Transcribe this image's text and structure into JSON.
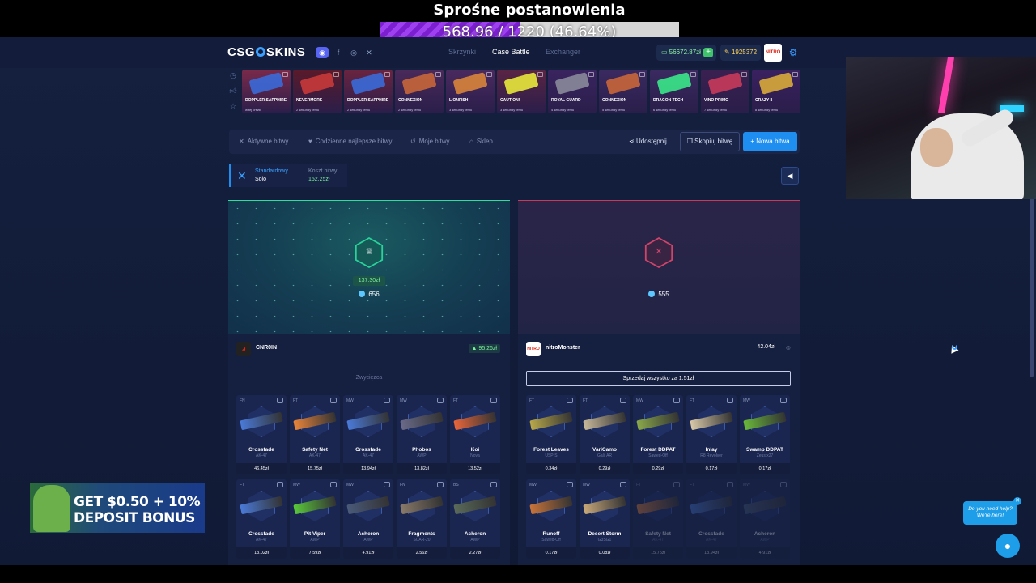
{
  "overlay": {
    "title": "Sprośne postanowienia",
    "progress_text": "568.96 / 1220 (46.64%)",
    "progress_fraction": 0.4664
  },
  "header": {
    "logo": "CSG",
    "logo_tail": "SKINS",
    "nav": [
      "Skrzynki",
      "Case Battle",
      "Exchanger"
    ],
    "balance": "56672.87zł",
    "coins": "1925372",
    "avatar_text": "NITRO"
  },
  "drops": [
    {
      "name": "DOPPLER SAPPHIRE",
      "sub": "w tej chwili",
      "color": "#7a2a4a",
      "gun": "#3a6ad8"
    },
    {
      "name": "NEVERMORE",
      "sub": "2 sekundy temu",
      "color": "#5a1a2a",
      "gun": "#c83a3a"
    },
    {
      "name": "DOPPLER SAPPHIRE",
      "sub": "2 sekundy temu",
      "color": "#6a2440",
      "gun": "#3a6ad8"
    },
    {
      "name": "CONNEXION",
      "sub": "2 sekundy temu",
      "color": "#4a2a5a",
      "gun": "#c8663a"
    },
    {
      "name": "LIONFISH",
      "sub": "3 sekundy temu",
      "color": "#4a2a60",
      "gun": "#d8843a"
    },
    {
      "name": "CAUTION!",
      "sub": "3 sekundy temu",
      "color": "#5a2444",
      "gun": "#e8e83a"
    },
    {
      "name": "ROYAL GUARD",
      "sub": "4 sekundy temu",
      "color": "#3a2460",
      "gun": "#8a8a9a"
    },
    {
      "name": "CONNEXION",
      "sub": "5 sekundy temu",
      "color": "#3a2a60",
      "gun": "#c8663a"
    },
    {
      "name": "DRAGON TECH",
      "sub": "6 sekundy temu",
      "color": "#3a2a60",
      "gun": "#3ae888"
    },
    {
      "name": "VINO PRIMO",
      "sub": "7 sekundy temu",
      "color": "#3a2050",
      "gun": "#c83a5a"
    },
    {
      "name": "CRAZY 8",
      "sub": "8 sekundy temu",
      "color": "#3a2060",
      "gun": "#d8a83a"
    }
  ],
  "tabs": [
    {
      "icon": "✕",
      "label": "Aktywne bitwy"
    },
    {
      "icon": "♥",
      "label": "Codzienne najlepsze bitwy"
    },
    {
      "icon": "↺",
      "label": "Moje bitwy"
    },
    {
      "icon": "⌂",
      "label": "Sklep"
    }
  ],
  "actions": {
    "share": "Udostępnij",
    "copy": "Skopiuj bitwę",
    "new": "+ Nowa bitwa"
  },
  "battle": {
    "mode_label": "Standardowy",
    "mode_value": "Solo",
    "cost_label": "Koszt bitwy",
    "cost_value": "152.25zł"
  },
  "left": {
    "win_amount": "137.30zł",
    "gems": "656",
    "player": "CNR0IN",
    "value": "▲ 95.26zł",
    "status": "Zwycięzca",
    "items": [
      {
        "wear": "FN",
        "name": "Crossfade",
        "sub": "AK-47",
        "price": "46.45zł",
        "color": "#4a7ad8",
        "dim": false
      },
      {
        "wear": "FT",
        "name": "Safety Net",
        "sub": "AK-47",
        "price": "15.75zł",
        "color": "#e8843a",
        "dim": false
      },
      {
        "wear": "MW",
        "name": "Crossfade",
        "sub": "AK-47",
        "price": "13.94zł",
        "color": "#4a7ad8",
        "dim": false
      },
      {
        "wear": "MW",
        "name": "Phobos",
        "sub": "AWP",
        "price": "13.82zł",
        "color": "#6a6a8a",
        "dim": false
      },
      {
        "wear": "FT",
        "name": "Koi",
        "sub": "Nova",
        "price": "13.52zł",
        "color": "#e8663a",
        "dim": false
      },
      {
        "wear": "FT",
        "name": "Crossfade",
        "sub": "AK-47",
        "price": "13.02zł",
        "color": "#4a7ad8",
        "dim": false
      },
      {
        "wear": "MW",
        "name": "Pit Viper",
        "sub": "AWP",
        "price": "7.59zł",
        "color": "#5ac83a",
        "dim": false
      },
      {
        "wear": "MW",
        "name": "Acheron",
        "sub": "AWP",
        "price": "4.91zł",
        "color": "#4a5a7a",
        "dim": false
      },
      {
        "wear": "FN",
        "name": "Fragments",
        "sub": "SCAR-20",
        "price": "2.56zł",
        "color": "#8a7a6a",
        "dim": false
      },
      {
        "wear": "BS",
        "name": "Acheron",
        "sub": "AWP",
        "price": "2.27zł",
        "color": "#5a6a5a",
        "dim": false
      }
    ]
  },
  "right": {
    "gems": "555",
    "player": "nitroMonster",
    "value": "42.04zł",
    "sell": "Sprzedaj wszystko za 1.51zł",
    "items": [
      {
        "wear": "FT",
        "name": "Forest Leaves",
        "sub": "USP-S",
        "price": "0.34zł",
        "color": "#b8a84a",
        "dim": false
      },
      {
        "wear": "FT",
        "name": "VariCamo",
        "sub": "Galil AR",
        "price": "0.29zł",
        "color": "#c8b89a",
        "dim": false
      },
      {
        "wear": "MW",
        "name": "Forest DDPAT",
        "sub": "Sawed-Off",
        "price": "0.29zł",
        "color": "#8aa84a",
        "dim": false
      },
      {
        "wear": "FT",
        "name": "Inlay",
        "sub": "R8 Revolver",
        "price": "0.17zł",
        "color": "#d8c8a8",
        "dim": false
      },
      {
        "wear": "MW",
        "name": "Swamp DDPAT",
        "sub": "Zeus x27",
        "price": "0.17zł",
        "color": "#6ab83a",
        "dim": false
      },
      {
        "wear": "MW",
        "name": "Runoff",
        "sub": "Sawed-Off",
        "price": "0.17zł",
        "color": "#c8743a",
        "dim": false
      },
      {
        "wear": "MW",
        "name": "Desert Storm",
        "sub": "G3SG1",
        "price": "0.08zł",
        "color": "#c8a87a",
        "dim": false
      },
      {
        "wear": "FT",
        "name": "Safety Net",
        "sub": "AK-47",
        "price": "15.75zł",
        "color": "#e8843a",
        "dim": true
      },
      {
        "wear": "FT",
        "name": "Crossfade",
        "sub": "AK-47",
        "price": "13.94zł",
        "color": "#4a7ad8",
        "dim": true
      },
      {
        "wear": "MW",
        "name": "Acheron",
        "sub": "AWP",
        "price": "4.91zł",
        "color": "#4a5a7a",
        "dim": true
      }
    ]
  },
  "ad": {
    "line1": "GET $0.50 + 10%",
    "line2": "DEPOSIT BONUS"
  },
  "chat": {
    "line1": "Do you need help?",
    "line2": "We're here!"
  }
}
